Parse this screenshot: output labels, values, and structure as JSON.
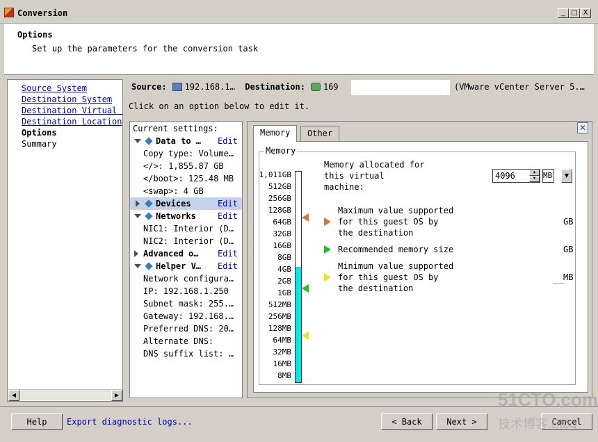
{
  "window": {
    "title": "Conversion",
    "minimize": "_",
    "maximize": "□",
    "close": "X"
  },
  "header": {
    "title": "Options",
    "subtitle": "Set up the parameters for the conversion task"
  },
  "nav": {
    "items": [
      {
        "label": "Source System"
      },
      {
        "label": "Destination System"
      },
      {
        "label": "Destination Virtual M"
      },
      {
        "label": "Destination Location"
      },
      {
        "label": "Options"
      },
      {
        "label": "Summary"
      }
    ]
  },
  "summary_bar": {
    "source_label": "Source:",
    "source_value": "192.168.1…",
    "destination_label": "Destination:",
    "destination_value": "169",
    "destination_server": "(VMware vCenter Server 5.…"
  },
  "hint": "Click on an option below to edit it.",
  "settings": {
    "header": "Current settings:",
    "edit": "Edit",
    "rows": {
      "data_to": "Data to …",
      "copy_type": "Copy type: Volume…",
      "root_part": "</>: 1,855.87 GB",
      "boot_part": "</boot>: 125.48 MB",
      "swap_part": "<swap>: 4 GB",
      "devices": "Devices",
      "networks": "Networks",
      "nic1": "NIC1: Interior (D…",
      "nic2": "NIC2: Interior (D…",
      "advanced": "Advanced o…",
      "helper": "Helper V…",
      "net_config": "Network configura…",
      "ip": "IP: 192.168.1.250",
      "subnet": "Subnet mask: 255.…",
      "gateway": "Gateway: 192.168.…",
      "pref_dns": "Preferred DNS: 20…",
      "alt_dns": "Alternate DNS:",
      "dns_suffix": "DNS suffix list: …"
    }
  },
  "tabs": {
    "memory": "Memory",
    "other": "Other"
  },
  "memory": {
    "group_label": "Memory",
    "scale": [
      "1,011GB",
      "512GB",
      "256GB",
      "128GB",
      "64GB",
      "32GB",
      "16GB",
      "8GB",
      "4GB",
      "2GB",
      "1GB",
      "512MB",
      "256MB",
      "128MB",
      "64MB",
      "32MB",
      "16MB",
      "8MB"
    ],
    "alloc_line1": "Memory allocated for",
    "alloc_line2": "this virtual",
    "alloc_line3": "machine:",
    "alloc_value": "4096",
    "alloc_unit": "MB",
    "legend": {
      "max_line1": "Maximum value supported",
      "max_line2": "for this guest OS by",
      "max_line3": "the destination",
      "max_unit": "GB",
      "rec_line1": "Recommended memory size",
      "rec_unit": "GB",
      "min_line1": "Minimum value supported",
      "min_line2": "for this guest OS by",
      "min_line3": "the destination",
      "min_unit": "MB"
    },
    "colors": {
      "max": "#d07840",
      "recommended": "#20c020",
      "minimum": "#f0e020",
      "fill": "#00e8e8"
    }
  },
  "footer": {
    "help": "Help",
    "export_logs": "Export diagnostic logs...",
    "back": "< Back",
    "next": "Next >",
    "cancel": "Cancel"
  },
  "watermark": {
    "line1": "51CTO.com",
    "line2": "技术博客 Blog"
  }
}
